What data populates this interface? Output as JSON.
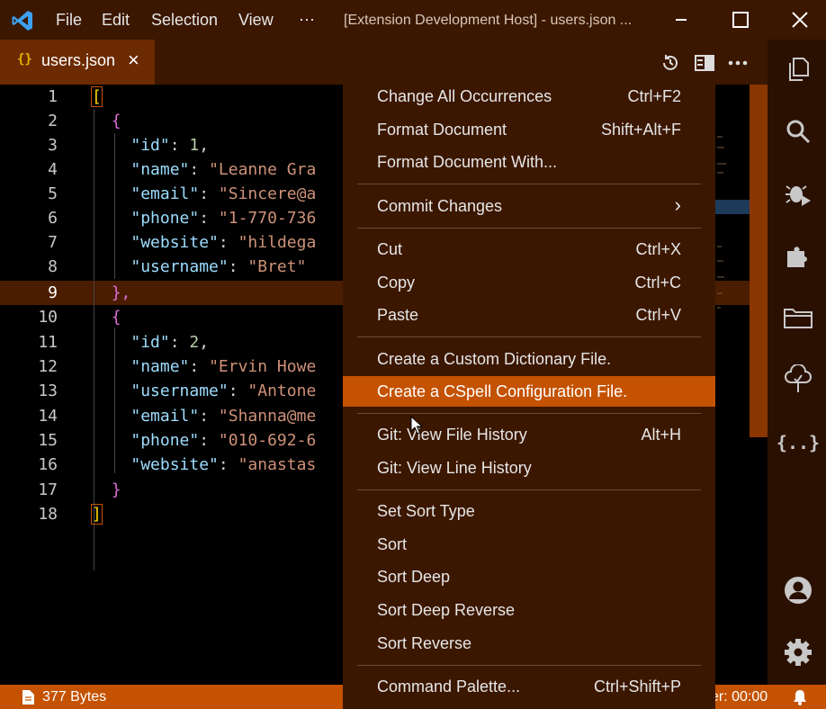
{
  "titlebar": {
    "menus": [
      "File",
      "Edit",
      "Selection",
      "View",
      "⋯"
    ],
    "title": "[Extension Development Host] - users.json ..."
  },
  "tab": {
    "icon": "{}",
    "name": "users.json"
  },
  "icons": {
    "logo": "vscode-logo-icon",
    "editor_actions": [
      "history-icon",
      "split-editor-icon",
      "more-actions-icon"
    ],
    "activity": [
      "explorer-icon",
      "search-icon",
      "debug-icon",
      "extensions-icon",
      "folders-icon",
      "cloud-icon",
      "json-icon",
      "account-icon",
      "settings-icon"
    ]
  },
  "editor": {
    "active_line": 9,
    "line_numbers": [
      "1",
      "2",
      "3",
      "4",
      "5",
      "6",
      "7",
      "8",
      "9",
      "10",
      "11",
      "12",
      "13",
      "14",
      "15",
      "16",
      "17",
      "18"
    ]
  },
  "code": {
    "open_array": "[",
    "open_obj": "{",
    "close_obj_comma": "},",
    "close_obj": "}",
    "close_array": "]",
    "colon": ": ",
    "comma": ",",
    "obj1": {
      "id_key": "\"id\"",
      "id_val": "1",
      "name_key": "\"name\"",
      "name_val": "\"Leanne Gra",
      "email_key": "\"email\"",
      "email_val": "\"Sincere@a",
      "phone_key": "\"phone\"",
      "phone_val": "\"1-770-736",
      "website_key": "\"website\"",
      "website_val": "\"hildega",
      "username_key": "\"username\"",
      "username_val": "\"Bret\""
    },
    "obj2": {
      "id_key": "\"id\"",
      "id_val": "2",
      "name_key": "\"name\"",
      "name_val": "\"Ervin Howe",
      "username_key": "\"username\"",
      "username_val": "\"Antone",
      "email_key": "\"email\"",
      "email_val": "\"Shanna@me",
      "phone_key": "\"phone\"",
      "phone_val": "\"010-692-6",
      "website_key": "\"website\"",
      "website_val": "\"anastas"
    }
  },
  "context_menu": {
    "items": [
      {
        "label": "Change All Occurrences",
        "shortcut": "Ctrl+F2"
      },
      {
        "label": "Format Document",
        "shortcut": "Shift+Alt+F"
      },
      {
        "label": "Format Document With...",
        "shortcut": ""
      },
      {
        "label": "Commit Changes",
        "shortcut": "›"
      },
      {
        "label": "Cut",
        "shortcut": "Ctrl+X"
      },
      {
        "label": "Copy",
        "shortcut": "Ctrl+C"
      },
      {
        "label": "Paste",
        "shortcut": "Ctrl+V"
      },
      {
        "label": "Create a Custom Dictionary File.",
        "shortcut": ""
      },
      {
        "label": "Create a CSpell Configuration File.",
        "shortcut": ""
      },
      {
        "label": "Git: View File History",
        "shortcut": "Alt+H"
      },
      {
        "label": "Git: View Line History",
        "shortcut": ""
      },
      {
        "label": "Set Sort Type",
        "shortcut": ""
      },
      {
        "label": "Sort",
        "shortcut": ""
      },
      {
        "label": "Sort Deep",
        "shortcut": ""
      },
      {
        "label": "Sort Deep Reverse",
        "shortcut": ""
      },
      {
        "label": "Sort Reverse",
        "shortcut": ""
      },
      {
        "label": "Command Palette...",
        "shortcut": "Ctrl+Shift+P"
      }
    ],
    "highlighted_index": 8
  },
  "statusbar": {
    "file_size": "377 Bytes",
    "timer": "er: 00:00"
  },
  "colors": {
    "title_bg": "#3b1700",
    "accent": "#c45200",
    "menu_bg": "#3b1700",
    "active_line_bg": "#4a1d00"
  }
}
